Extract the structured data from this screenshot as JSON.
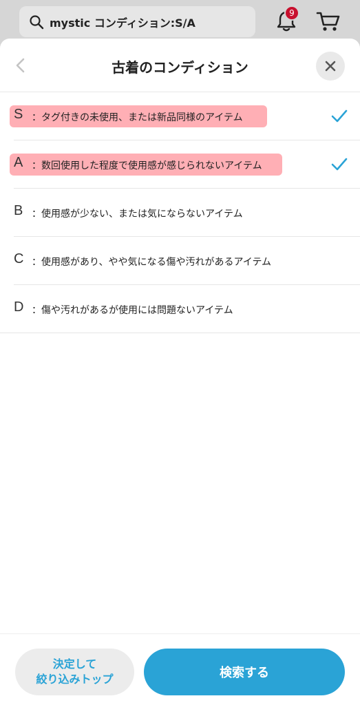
{
  "search": {
    "query": "mystic コンディション:S/A"
  },
  "header": {
    "notification_count": "9"
  },
  "sheet": {
    "title": "古着のコンディション",
    "options": [
      {
        "letter": "S",
        "desc": "：タグ付きの未使用、または新品同様のアイテム",
        "checked": true,
        "highlighted": true
      },
      {
        "letter": "A",
        "desc": "：数回使用した程度で使用感が感じられないアイテム",
        "checked": true,
        "highlighted": true
      },
      {
        "letter": "B",
        "desc": "：使用感が少ない、または気にならないアイテム",
        "checked": false,
        "highlighted": false
      },
      {
        "letter": "C",
        "desc": "：使用感があり、やや気になる傷や汚れがあるアイテム",
        "checked": false,
        "highlighted": false
      },
      {
        "letter": "D",
        "desc": "：傷や汚れがあるが使用には問題ないアイテム",
        "checked": false,
        "highlighted": false
      }
    ]
  },
  "footer": {
    "secondary_line1": "決定して",
    "secondary_line2": "絞り込みトップ",
    "primary_label": "検索する"
  },
  "colors": {
    "accent": "#2aa3d6",
    "badge": "#c8102e",
    "highlight": "#ff6e78"
  },
  "icons": {
    "search": "search-icon",
    "bell": "bell-icon",
    "cart": "cart-icon",
    "back": "chevron-left-icon",
    "close": "close-icon",
    "check": "check-icon"
  }
}
